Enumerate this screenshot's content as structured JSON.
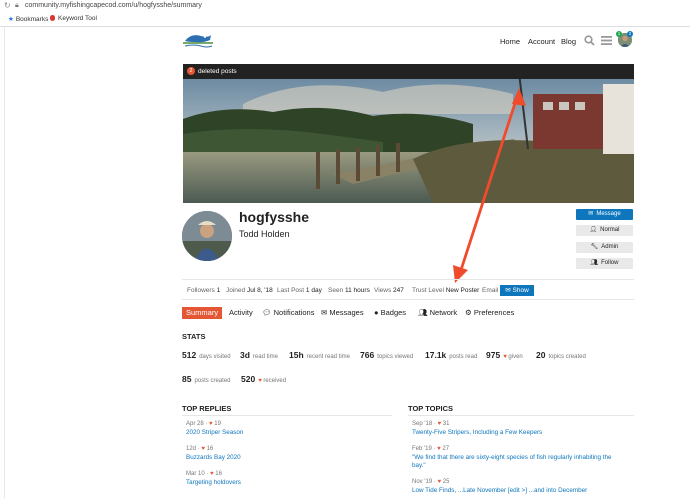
{
  "browser": {
    "url": "community.myfishingcapecod.com/u/hogfysshe/summary",
    "bookmarks": [
      "Bookmarks",
      "Keyword Tool"
    ]
  },
  "header": {
    "nav": [
      "Home",
      "Account",
      "Blog"
    ],
    "notif_count_1": "1",
    "notif_count_2": "2"
  },
  "cover": {
    "deleted_posts_label": "deleted posts",
    "deleted_count": "2"
  },
  "profile": {
    "username": "hogfysshe",
    "name": "Todd Holden",
    "buttons": [
      "Message",
      "Normal",
      "Admin",
      "Follow"
    ]
  },
  "info": {
    "followers_label": "Followers",
    "followers": "1",
    "joined_label": "Joined",
    "joined": "Jul 8, '18",
    "lastpost_label": "Last Post",
    "lastpost": "1 day",
    "seen_label": "Seen",
    "seen": "11 hours",
    "views_label": "Views",
    "views": "247",
    "trust_label": "Trust Level",
    "trust": "New Poster",
    "email_label": "Email",
    "show_label": "Show"
  },
  "tabs": [
    "Summary",
    "Activity",
    "Notifications",
    "Messages",
    "Badges",
    "Network",
    "Preferences"
  ],
  "stats": {
    "title": "STATS",
    "items": [
      {
        "n": "512",
        "label": "days visited"
      },
      {
        "n": "3d",
        "label": "read time"
      },
      {
        "n": "15h",
        "label": "recent read time"
      },
      {
        "n": "766",
        "label": "topics viewed"
      },
      {
        "n": "17.1k",
        "label": "posts read"
      },
      {
        "n": "975",
        "label": "given"
      },
      {
        "n": "20",
        "label": "topics created"
      },
      {
        "n": "85",
        "label": "posts created"
      },
      {
        "n": "520",
        "label": "received"
      }
    ]
  },
  "top_replies": {
    "title": "TOP REPLIES",
    "items": [
      {
        "meta": "Apr 28 · ",
        "likes": "19",
        "title": "2020 Striper Season"
      },
      {
        "meta": "12d · ",
        "likes": "16",
        "title": "Buzzards Bay 2020"
      },
      {
        "meta": "Mar 10 · ",
        "likes": "16",
        "title": "Targeting holdovers"
      }
    ]
  },
  "top_topics": {
    "title": "TOP TOPICS",
    "items": [
      {
        "meta": "Sep '18 · ",
        "likes": "31",
        "title": "Twenty-Five Stripers, Including a Few Keepers"
      },
      {
        "meta": "Feb '19 · ",
        "likes": "27",
        "title": "\"We find that there are sixty-eight species of fish regularly inhabiting the",
        "title2": "bay.\""
      },
      {
        "meta": "Nov '19 · ",
        "likes": "25",
        "title": "Low Tide Finds, ...Late November [edit >] ...and into December"
      }
    ]
  }
}
